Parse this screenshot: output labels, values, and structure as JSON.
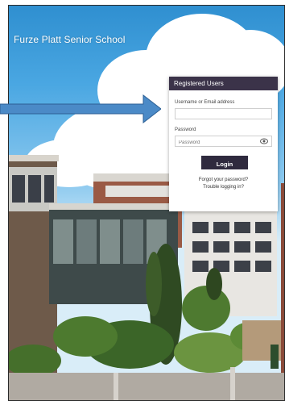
{
  "page": {
    "school_name": "Furze Platt Senior School"
  },
  "login": {
    "header": "Registered Users",
    "username_label": "Username or Email address",
    "username_value": "",
    "password_label": "Password",
    "password_placeholder": "Password",
    "login_label": "Login",
    "forgot_password": "Forgot your password?",
    "trouble": "Trouble logging in?"
  },
  "colors": {
    "header_bg": "#3b3349",
    "button_bg": "#2f2a3e",
    "arrow": "#4b8ac7"
  },
  "icons": {
    "password_toggle": "eye-icon",
    "pointer": "arrow-icon"
  }
}
